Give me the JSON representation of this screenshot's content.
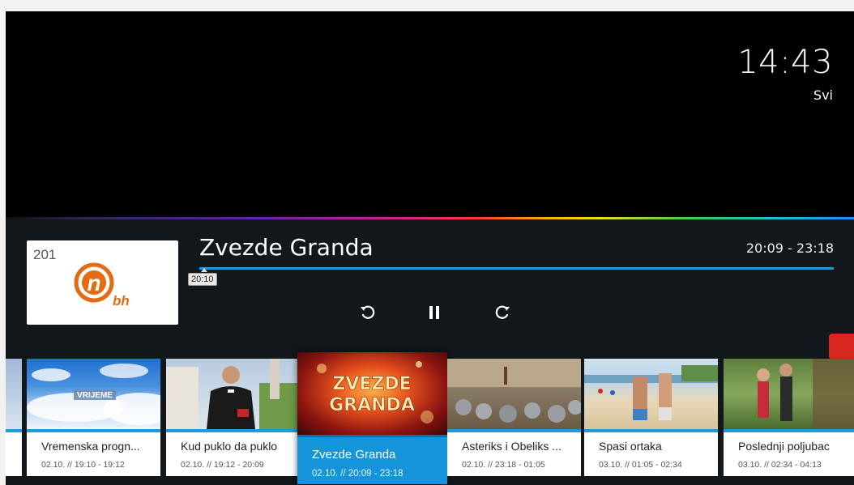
{
  "header": {
    "clock": "14:43",
    "filter": "Svi"
  },
  "channel": {
    "number": "201",
    "logo_text": "n",
    "logo_sub": "bh"
  },
  "program": {
    "title": "Zvezde Granda",
    "time_range": "20:09 - 23:18",
    "progress_tooltip": "20:10",
    "progress_fraction": 0.005
  },
  "controls": {
    "rewind_icon": "rewind-icon",
    "pause_icon": "pause-icon",
    "forward_icon": "forward-icon"
  },
  "thumbnails": {
    "vrijeme_text": "VRIJEME",
    "zvezde_line1": "ZVEZDE",
    "zvezde_line2": "GRANDA"
  },
  "tiles": [
    {
      "title": "Vremenska progn...",
      "time": "02.10. // 19:10 - 19:12"
    },
    {
      "title": "Kud puklo da puklo",
      "time": "02.10. // 19:12 - 20:09"
    },
    {
      "title": "Zvezde Granda",
      "time": "02.10. // 20:09 - 23:18"
    },
    {
      "title": "Asteriks i Obeliks ...",
      "time": "02.10. // 23:18 - 01:05"
    },
    {
      "title": "Spasi ortaka",
      "time": "03.10. // 01:05 - 02:34"
    },
    {
      "title": "Poslednji poljubac",
      "time": "03.10. // 02:34 - 04:13"
    }
  ],
  "colors": {
    "accent": "#1593db",
    "logo_orange": "#e36b12",
    "panel": "#12171c"
  }
}
